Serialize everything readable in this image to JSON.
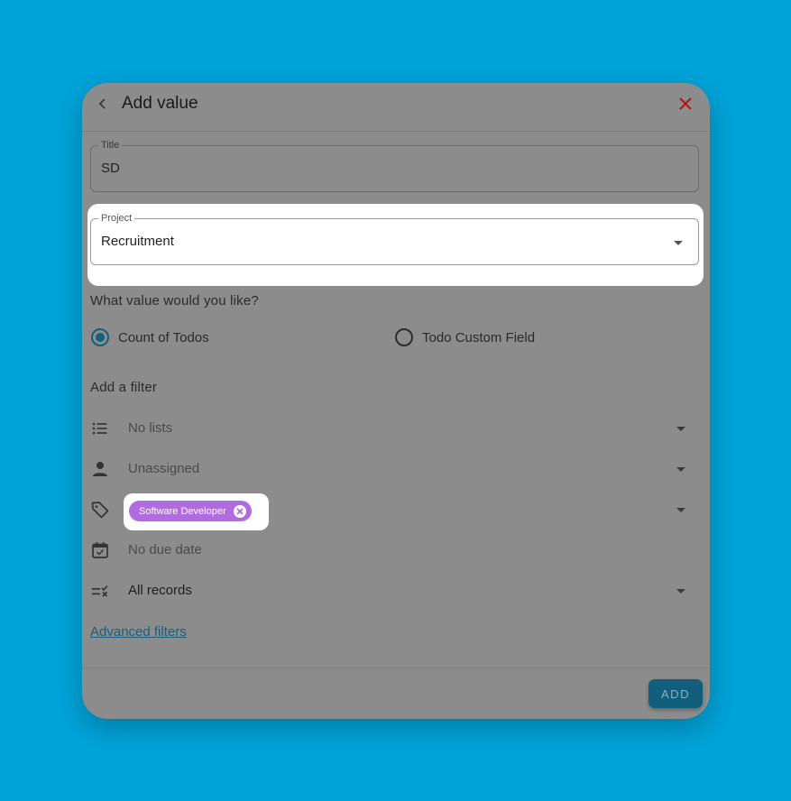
{
  "dialog": {
    "title": "Add value",
    "back_icon": "chevron-left-icon",
    "close_icon": "close-icon",
    "close_color": "#b0171f"
  },
  "fields": {
    "title": {
      "label": "Title",
      "value": "SD"
    },
    "project": {
      "label": "Project",
      "value": "Recruitment"
    }
  },
  "value_type": {
    "question": "What value would you like?",
    "options": [
      {
        "label": "Count of Todos",
        "selected": true
      },
      {
        "label": "Todo Custom Field",
        "selected": false
      }
    ]
  },
  "filters": {
    "heading": "Add a filter",
    "lists": {
      "icon": "list-icon",
      "value": "No lists"
    },
    "assignee": {
      "icon": "person-icon",
      "value": "Unassigned"
    },
    "tags": {
      "icon": "tag-icon",
      "chips": [
        {
          "label": "Software Developer",
          "color": "#b06be0"
        }
      ]
    },
    "due_date": {
      "icon": "calendar-check-icon",
      "value": "No due date"
    },
    "records": {
      "icon": "checklist-icon",
      "value": "All records"
    },
    "advanced_link": "Advanced filters"
  },
  "footer": {
    "add_label": "ADD"
  }
}
